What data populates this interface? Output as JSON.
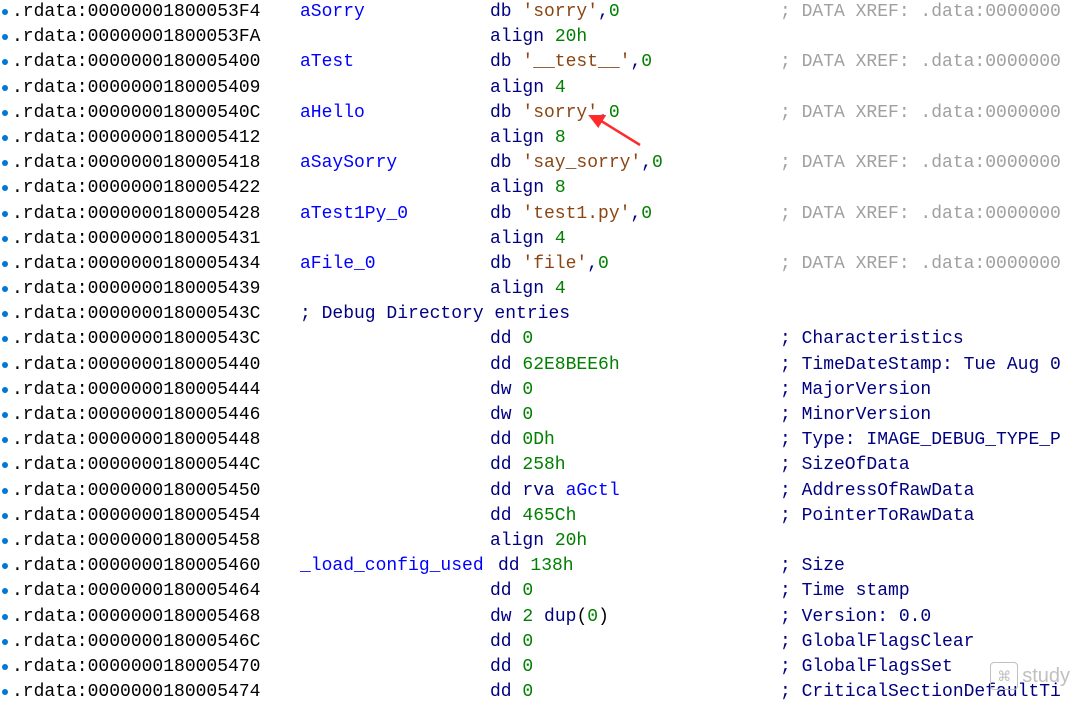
{
  "rows": [
    {
      "addr": ".rdata:00000001800053F4",
      "label": "aSorry",
      "op": {
        "m": "db ",
        "s": "'sorry'",
        "t": ",0"
      },
      "comment": "; DATA XREF: .data:0000000"
    },
    {
      "addr": ".rdata:00000001800053FA",
      "label": "",
      "op": {
        "m": "align ",
        "v": "20h"
      },
      "comment": ""
    },
    {
      "addr": ".rdata:0000000180005400",
      "label": "aTest",
      "op": {
        "m": "db ",
        "s": "'__test__'",
        "t": ",0"
      },
      "comment": "; DATA XREF: .data:0000000"
    },
    {
      "addr": ".rdata:0000000180005409",
      "label": "",
      "op": {
        "m": "align ",
        "v": "4"
      },
      "comment": ""
    },
    {
      "addr": ".rdata:000000018000540C",
      "label": "aHello",
      "op": {
        "m": "db ",
        "s": "'sorry'",
        "t": ",0"
      },
      "comment": "; DATA XREF: .data:0000000"
    },
    {
      "addr": ".rdata:0000000180005412",
      "label": "",
      "op": {
        "m": "align ",
        "v": "8"
      },
      "comment": ""
    },
    {
      "addr": ".rdata:0000000180005418",
      "label": "aSaySorry",
      "op": {
        "m": "db ",
        "s": "'say_sorry'",
        "t": ",0"
      },
      "comment": "; DATA XREF: .data:0000000"
    },
    {
      "addr": ".rdata:0000000180005422",
      "label": "",
      "op": {
        "m": "align ",
        "v": "8"
      },
      "comment": ""
    },
    {
      "addr": ".rdata:0000000180005428",
      "label": "aTest1Py_0",
      "op": {
        "m": "db ",
        "s": "'test1.py'",
        "t": ",0"
      },
      "comment": "; DATA XREF: .data:0000000"
    },
    {
      "addr": ".rdata:0000000180005431",
      "label": "",
      "op": {
        "m": "align ",
        "v": "4"
      },
      "comment": ""
    },
    {
      "addr": ".rdata:0000000180005434",
      "label": "aFile_0",
      "op": {
        "m": "db ",
        "s": "'file'",
        "t": ",0"
      },
      "comment": "; DATA XREF: .data:0000000"
    },
    {
      "addr": ".rdata:0000000180005439",
      "label": "",
      "op": {
        "m": "align ",
        "v": "4"
      },
      "comment": ""
    },
    {
      "addr": ".rdata:000000018000543C",
      "label": "",
      "op": {
        "cmt": "; Debug Directory entries"
      },
      "comment": ""
    },
    {
      "addr": ".rdata:000000018000543C",
      "label": "",
      "op": {
        "m": "dd ",
        "v": "0"
      },
      "comment": "; Characteristics"
    },
    {
      "addr": ".rdata:0000000180005440",
      "label": "",
      "op": {
        "m": "dd ",
        "v": "62E8BEE6h"
      },
      "comment": "; TimeDateStamp: Tue Aug 0"
    },
    {
      "addr": ".rdata:0000000180005444",
      "label": "",
      "op": {
        "m": "dw ",
        "v": "0"
      },
      "comment": "; MajorVersion"
    },
    {
      "addr": ".rdata:0000000180005446",
      "label": "",
      "op": {
        "m": "dw ",
        "v": "0"
      },
      "comment": "; MinorVersion"
    },
    {
      "addr": ".rdata:0000000180005448",
      "label": "",
      "op": {
        "m": "dd ",
        "v": "0Dh"
      },
      "comment": "; Type: IMAGE_DEBUG_TYPE_P"
    },
    {
      "addr": ".rdata:000000018000544C",
      "label": "",
      "op": {
        "m": "dd ",
        "v": "258h"
      },
      "comment": "; SizeOfData"
    },
    {
      "addr": ".rdata:0000000180005450",
      "label": "",
      "op": {
        "m": "dd ",
        "rva": "rva aGctl"
      },
      "comment": "; AddressOfRawData"
    },
    {
      "addr": ".rdata:0000000180005454",
      "label": "",
      "op": {
        "m": "dd ",
        "v": "465Ch"
      },
      "comment": "; PointerToRawData"
    },
    {
      "addr": ".rdata:0000000180005458",
      "label": "",
      "op": {
        "m": "align ",
        "v": "20h"
      },
      "comment": ""
    },
    {
      "addr": ".rdata:0000000180005460",
      "label": "_load_config_used",
      "op": {
        "m": "dd ",
        "v": "138h",
        "inline": true
      },
      "comment": "; Size"
    },
    {
      "addr": ".rdata:0000000180005464",
      "label": "",
      "op": {
        "m": "dd ",
        "v": "0"
      },
      "comment": "; Time stamp"
    },
    {
      "addr": ".rdata:0000000180005468",
      "label": "",
      "op": {
        "m": "dw ",
        "v": "2",
        "dup": " dup(0)"
      },
      "comment": "; Version: 0.0"
    },
    {
      "addr": ".rdata:000000018000546C",
      "label": "",
      "op": {
        "m": "dd ",
        "v": "0"
      },
      "comment": "; GlobalFlagsClear"
    },
    {
      "addr": ".rdata:0000000180005470",
      "label": "",
      "op": {
        "m": "dd ",
        "v": "0"
      },
      "comment": "; GlobalFlagsSet"
    },
    {
      "addr": ".rdata:0000000180005474",
      "label": "",
      "op": {
        "m": "dd ",
        "v": "0"
      },
      "comment": "; CriticalSectionDefaultTi"
    }
  ],
  "watermark": {
    "text": "study",
    "icon": "⌘"
  }
}
